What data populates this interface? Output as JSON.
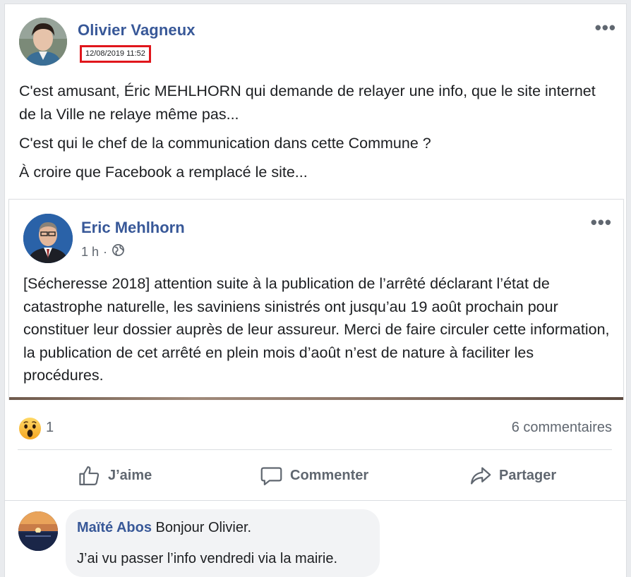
{
  "post": {
    "author": "Olivier Vagneux",
    "timestamp": "12/08/2019 11:52",
    "more_icon": "•••",
    "paragraphs": [
      "C'est amusant, Éric MEHLHORN qui demande de relayer une info, que le site internet de la Ville ne relaye même pas...",
      "C'est qui le chef de la communication dans cette Commune ?",
      "À croire que Facebook a remplacé le site..."
    ]
  },
  "shared_post": {
    "author": "Eric Mehlhorn",
    "time": "1 h",
    "separator": "·",
    "privacy_icon": "globe-icon",
    "more_icon": "•••",
    "text": "[Sécheresse 2018] attention suite à la publication de l’arrêté déclarant l’état de catastrophe naturelle, les saviniens sinistrés ont jusqu’au 19 août prochain pour constituer leur dossier auprès de leur assureur. Merci de faire circuler cette information, la publication de cet arrêté en plein mois d’août n’est de nature à faciliter les procédures."
  },
  "reactions": {
    "icon": "wow-reaction-icon",
    "count": "1",
    "comments_count": "6 commentaires"
  },
  "actions": {
    "like": "J’aime",
    "comment": "Commenter",
    "share": "Partager"
  },
  "comment": {
    "author": "Maïté Abos",
    "text_line1": "Bonjour Olivier.",
    "text_line2": "J’ai vu passer l’info vendredi via la mairie."
  },
  "colors": {
    "link_blue": "#385898",
    "secondary_text": "#606770",
    "highlight_red": "#e0161c",
    "bubble_bg": "#f2f3f5"
  }
}
